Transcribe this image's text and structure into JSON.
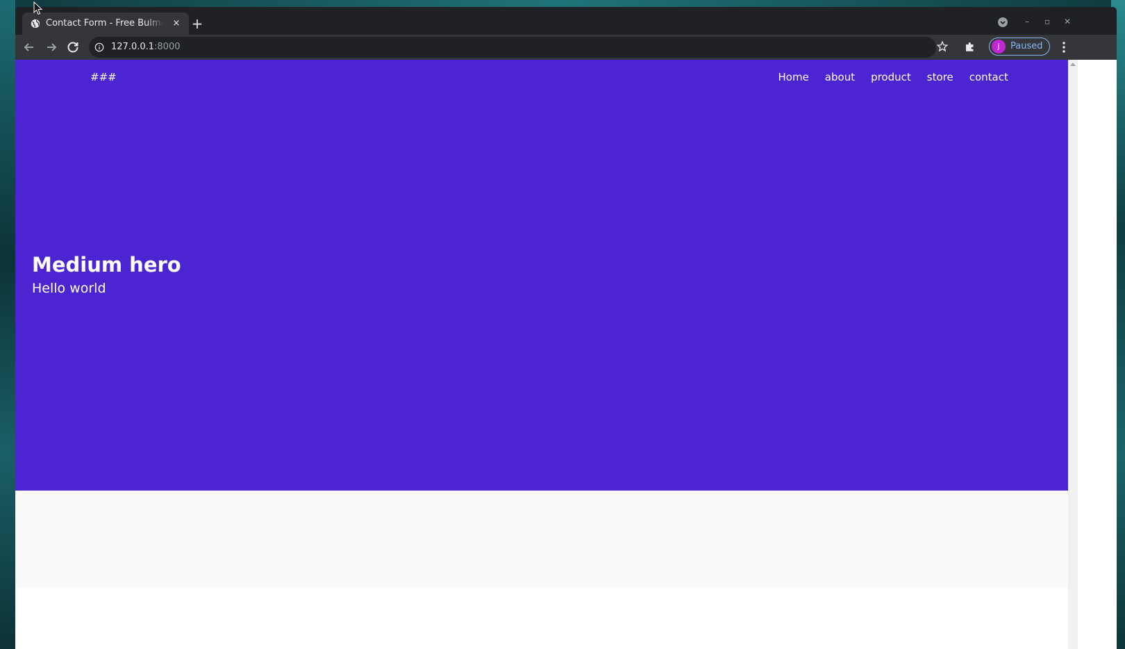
{
  "browser": {
    "tab_title": "Contact Form - Free Bulma",
    "tab_close": "×",
    "new_tab": "+",
    "url_host": "127.0.0.1",
    "url_port": ":8000",
    "profile_initial": "j",
    "profile_status": "Paused",
    "window_buttons": [
      "–",
      "▫",
      "✕"
    ]
  },
  "page": {
    "brand": "###",
    "nav": [
      {
        "label": "Home"
      },
      {
        "label": "about"
      },
      {
        "label": "product"
      },
      {
        "label": "store"
      },
      {
        "label": "contact"
      }
    ],
    "hero": {
      "title": "Medium hero",
      "subtitle": "Hello world"
    }
  },
  "colors": {
    "hero_bg": "#4c24d2",
    "chrome_dark": "#202124",
    "chrome_toolbar": "#35363a",
    "profile_accent": "#8ab4f8",
    "avatar_bg": "#c026d3"
  }
}
